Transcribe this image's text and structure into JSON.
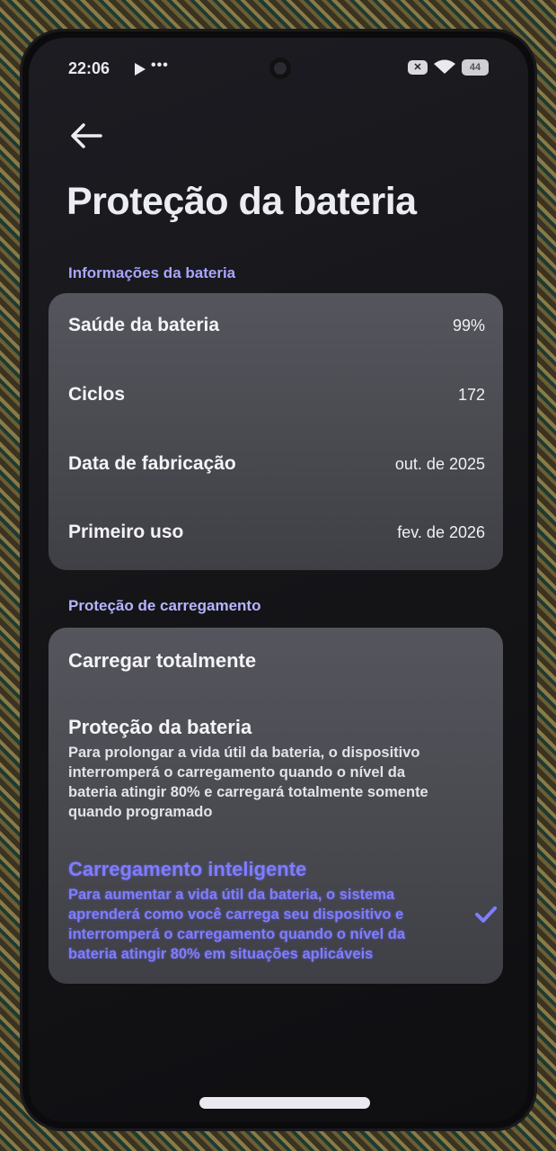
{
  "status_bar": {
    "time": "22:06",
    "more": "•••",
    "battery_level": "44"
  },
  "header": {
    "title": "Proteção da bateria"
  },
  "battery_info": {
    "section_label": "Informações da bateria",
    "rows": [
      {
        "label": "Saúde da bateria",
        "value": "99%"
      },
      {
        "label": "Ciclos",
        "value": "172"
      },
      {
        "label": "Data de fabricação",
        "value": "out. de 2025"
      },
      {
        "label": "Primeiro uso",
        "value": "fev. de 2026"
      }
    ]
  },
  "charging_protection": {
    "section_label": "Proteção de carregamento",
    "options": [
      {
        "title": "Carregar totalmente",
        "description": "",
        "selected": false
      },
      {
        "title": "Proteção da bateria",
        "description": "Para prolongar a vida útil da bateria, o dispositivo interromperá o carregamento quando o nível da bateria atingir 80% e carregará totalmente somente quando programado",
        "selected": false
      },
      {
        "title": "Carregamento inteligente",
        "description": "Para aumentar a vida útil da bateria, o sistema aprenderá como você carrega seu dispositivo e interromperá o carregamento quando o nível da bateria atingir 80% em situações aplicáveis",
        "selected": true
      }
    ]
  },
  "colors": {
    "accent": "#7f7dff",
    "section_label": "#a9a6ff",
    "card": "#4b4b53",
    "background": "#17171a"
  }
}
